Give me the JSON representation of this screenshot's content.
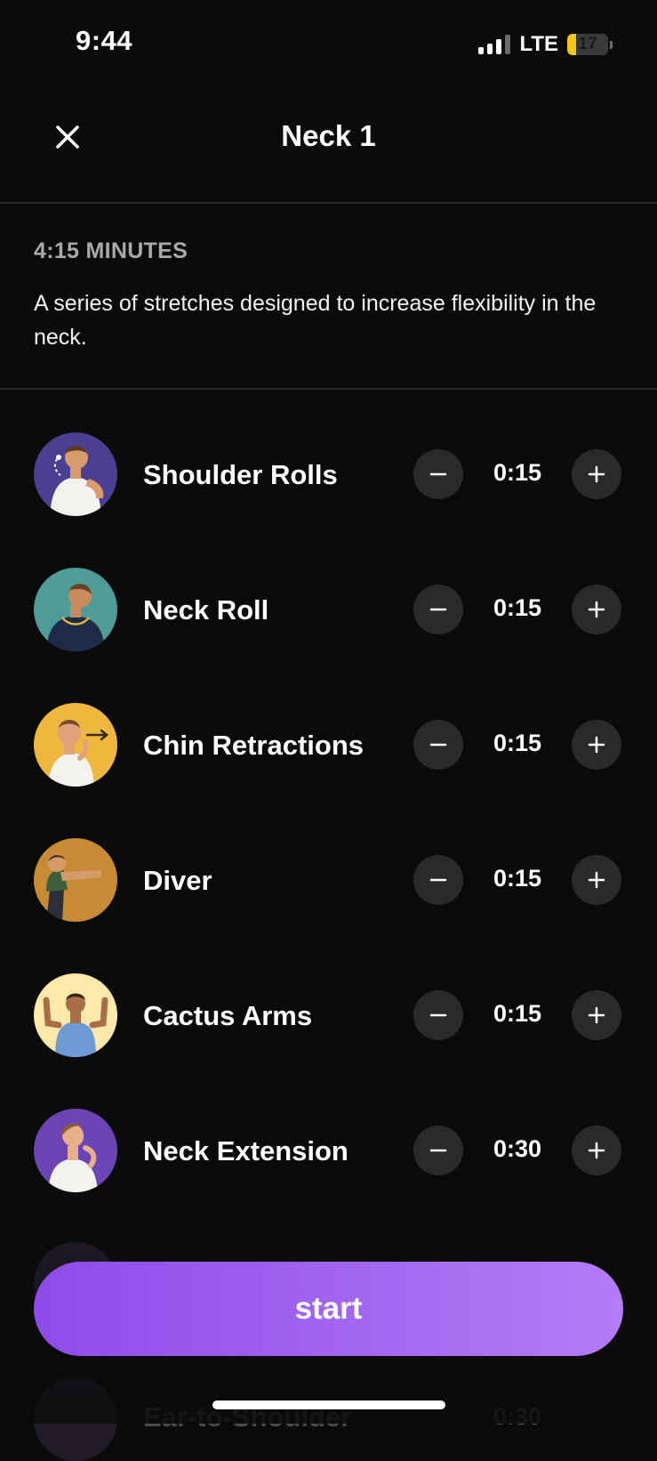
{
  "status_bar": {
    "time": "9:44",
    "network": "LTE",
    "battery": "17"
  },
  "header": {
    "title": "Neck 1"
  },
  "summary": {
    "duration": "4:15 MINUTES",
    "description": "A series of stretches designed to increase flexibility in the neck."
  },
  "exercises": [
    {
      "name": "Shoulder Rolls",
      "duration": "0:15",
      "icon": "shoulder-rolls-illustration",
      "color": "#4a3f91"
    },
    {
      "name": "Neck Roll",
      "duration": "0:15",
      "icon": "neck-roll-illustration",
      "color": "#4e9b98"
    },
    {
      "name": "Chin Retractions",
      "duration": "0:15",
      "icon": "chin-retractions-illustration",
      "color": "#efb73e"
    },
    {
      "name": "Diver",
      "duration": "0:15",
      "icon": "diver-illustration",
      "color": "#c88a34"
    },
    {
      "name": "Cactus Arms",
      "duration": "0:15",
      "icon": "cactus-arms-illustration",
      "color": "#fde9a9"
    },
    {
      "name": "Neck Extension",
      "duration": "0:30",
      "icon": "neck-extension-illustration",
      "color": "#6a45b3"
    }
  ],
  "partially_visible_exercise": {
    "name": "Ear-to-Shoulder",
    "duration": "0:30"
  },
  "start_button": {
    "label": "start"
  },
  "colors": {
    "background": "#0b0b0b",
    "accent_start": "#8e4bea",
    "accent_end": "#b57cf7",
    "control_bg": "#2a2a2a"
  }
}
